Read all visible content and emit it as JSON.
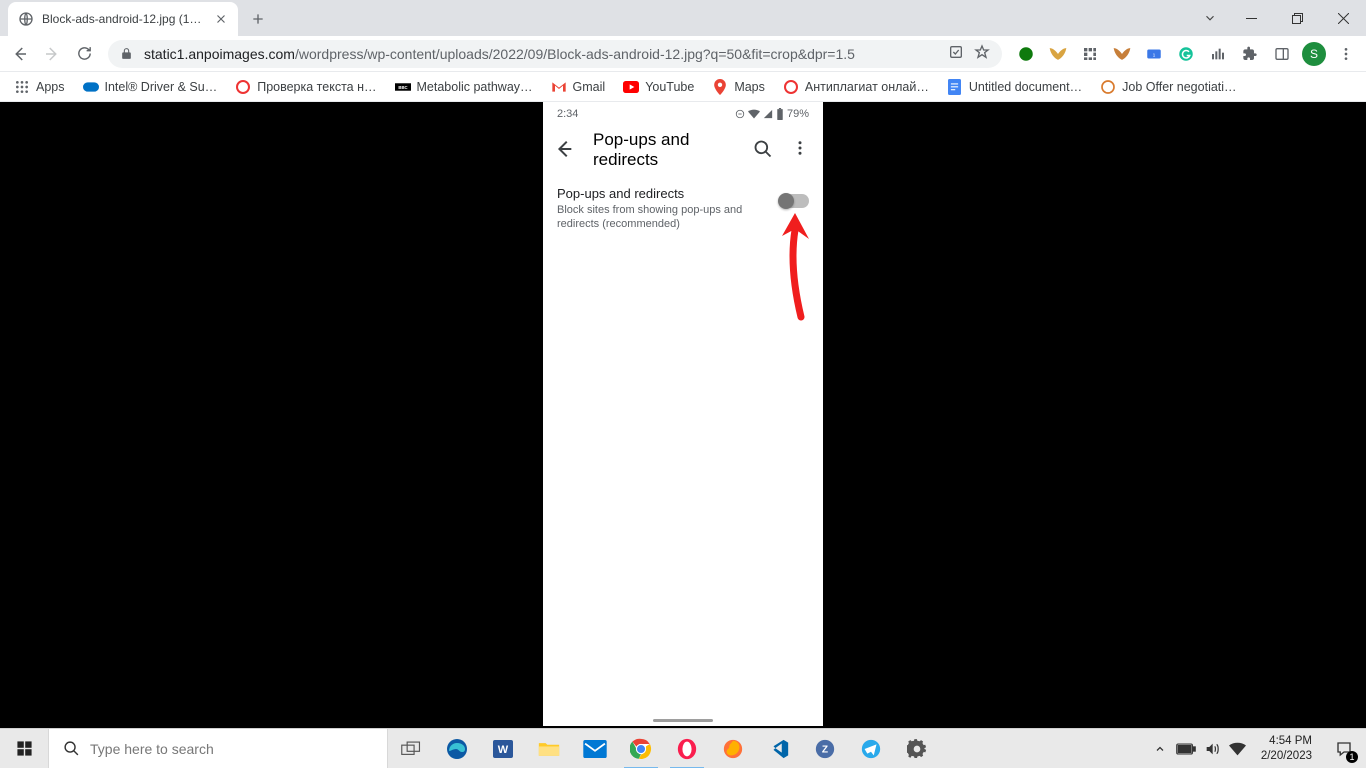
{
  "browser": {
    "tab": {
      "title": "Block-ads-android-12.jpg (1080×…"
    },
    "url": {
      "host": "static1.anpoimages.com",
      "path": "/wordpress/wp-content/uploads/2022/09/Block-ads-android-12.jpg?q=50&fit=crop&dpr=1.5"
    },
    "avatar_letter": "S",
    "bookmarks": [
      {
        "label": "Apps"
      },
      {
        "label": "Intel® Driver & Su…"
      },
      {
        "label": "Проверка текста н…"
      },
      {
        "label": "Metabolic pathway…"
      },
      {
        "label": "Gmail"
      },
      {
        "label": "YouTube"
      },
      {
        "label": "Maps"
      },
      {
        "label": "Антиплагиат онлай…"
      },
      {
        "label": "Untitled document…"
      },
      {
        "label": "Job Offer negotiati…"
      }
    ]
  },
  "phone": {
    "status": {
      "time": "2:34",
      "battery": "79%"
    },
    "page_title": "Pop-ups and redirects",
    "setting": {
      "title": "Pop-ups and redirects",
      "subtitle": "Block sites from showing pop-ups and redirects (recommended)"
    }
  },
  "taskbar": {
    "search_placeholder": "Type here to search",
    "clock_time": "4:54 PM",
    "clock_date": "2/20/2023",
    "notif_count": "1"
  }
}
